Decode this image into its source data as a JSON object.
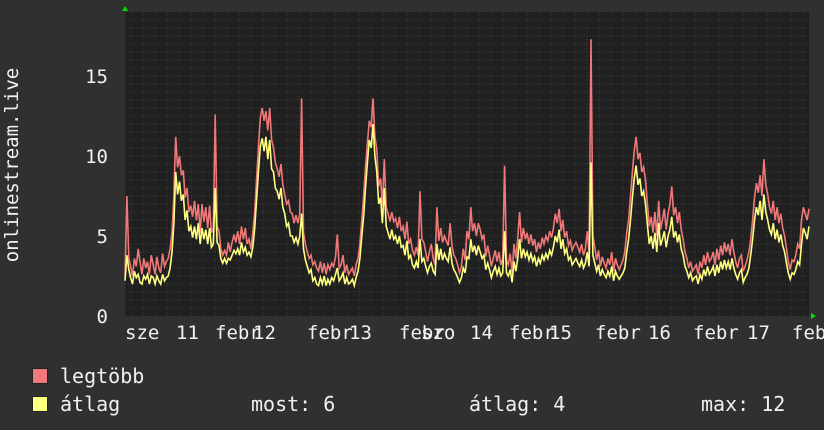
{
  "chart_data": {
    "type": "line",
    "ylabel": "onlinestream.live",
    "ylim": [
      0,
      19
    ],
    "yticks": [
      0,
      5,
      10,
      15
    ],
    "grid": true,
    "xtick_labels": [
      "sze",
      "11",
      "febr",
      "12",
      "febr",
      "13",
      "febr",
      "szo",
      "14",
      "febr",
      "15",
      "febr",
      "16",
      "febr",
      "17",
      "feb"
    ],
    "series": [
      {
        "name": "legtöbb",
        "color": "#f07878",
        "values": [
          2.5,
          7.5,
          3.6,
          3.1,
          2.5,
          3.6,
          3.1,
          4.2,
          3.4,
          2.6,
          3.6,
          3.0,
          3.4,
          2.6,
          3.8,
          3.2,
          2.6,
          3.7,
          3.0,
          2.7,
          3.9,
          3.1,
          3.4,
          3.6,
          4.2,
          5.2,
          7.6,
          11.2,
          9.3,
          10.0,
          8.8,
          9.1,
          7.4,
          8.0,
          6.5,
          6.9,
          6.2,
          7.2,
          6.0,
          7.0,
          5.2,
          7.0,
          5.9,
          6.8,
          5.5,
          6.9,
          5.2,
          5.5,
          12.6,
          5.6,
          5.3,
          4.2,
          3.8,
          4.1,
          3.8,
          4.6,
          4.0,
          4.6,
          5.1,
          4.6,
          5.3,
          4.5,
          5.6,
          4.8,
          5.5,
          4.5,
          4.8,
          4.2,
          5.2,
          6.5,
          8.5,
          10.5,
          12.4,
          13.0,
          12.2,
          12.8,
          11.6,
          13.0,
          11.0,
          10.5,
          9.6,
          9.2,
          8.7,
          9.5,
          8.2,
          7.6,
          7.0,
          7.2,
          6.5,
          6.4,
          5.8,
          6.3,
          5.8,
          6.4,
          13.6,
          5.2,
          4.5,
          4.0,
          3.6,
          3.8,
          3.2,
          3.4,
          3.0,
          2.8,
          3.4,
          2.7,
          3.3,
          2.6,
          3.2,
          2.9,
          3.3,
          3.1,
          3.7,
          5.1,
          3.0,
          3.2,
          3.8,
          2.7,
          3.2,
          2.6,
          2.8,
          3.0,
          2.5,
          3.2,
          3.6,
          4.5,
          6.0,
          7.5,
          9.3,
          10.8,
          12.2,
          11.8,
          13.6,
          11.2,
          10.4,
          8.1,
          8.6,
          6.9,
          9.8,
          6.8,
          6.4,
          5.9,
          6.5,
          5.9,
          6.1,
          5.5,
          6.2,
          5.3,
          5.6,
          4.8,
          5.9,
          4.5,
          4.8,
          4.1,
          3.8,
          4.3,
          3.8,
          7.8,
          4.8,
          4.6,
          4.0,
          3.4,
          4.0,
          4.5,
          3.6,
          3.2,
          6.8,
          4.7,
          5.5,
          4.6,
          5.0,
          4.7,
          4.4,
          5.8,
          4.4,
          3.8,
          3.6,
          3.2,
          2.7,
          3.1,
          4.2,
          3.5,
          5.3,
          4.8,
          6.8,
          5.3,
          5.8,
          5.0,
          5.8,
          5.4,
          4.8,
          5.1,
          3.7,
          4.4,
          3.8,
          3.1,
          3.6,
          4.1,
          3.4,
          4.0,
          3.2,
          3.6,
          9.4,
          3.5,
          3.2,
          3.9,
          2.7,
          4.5,
          3.6,
          4.8,
          6.5,
          4.6,
          5.5,
          4.8,
          5.2,
          4.5,
          5.1,
          4.4,
          4.8,
          4.0,
          4.6,
          4.2,
          4.9,
          4.5,
          5.0,
          4.7,
          5.3,
          4.9,
          5.5,
          6.4,
          5.8,
          6.7,
          5.3,
          6.0,
          4.9,
          5.3,
          4.4,
          4.7,
          4.1,
          4.4,
          4.6,
          4.3,
          4.0,
          4.5,
          3.8,
          4.2,
          5.3,
          4.0,
          17.3,
          5.0,
          4.3,
          3.5,
          4.1,
          3.1,
          3.7,
          3.3,
          3.0,
          3.6,
          3.2,
          4.0,
          2.8,
          3.6,
          3.2,
          2.9,
          3.2,
          3.5,
          4.0,
          5.2,
          6.0,
          7.5,
          9.0,
          10.3,
          11.2,
          9.8,
          10.2,
          9.0,
          9.3,
          8.5,
          7.0,
          5.6,
          6.2,
          5.2,
          6.5,
          5.0,
          7.2,
          5.4,
          6.0,
          6.7,
          5.4,
          6.4,
          7.0,
          8.1,
          6.3,
          6.8,
          5.8,
          6.5,
          5.4,
          4.8,
          4.0,
          3.6,
          3.0,
          3.4,
          2.8,
          3.0,
          3.2,
          2.6,
          3.4,
          3.0,
          3.8,
          3.2,
          4.0,
          3.4,
          3.6,
          4.0,
          3.2,
          4.2,
          3.5,
          4.4,
          3.8,
          4.6,
          4.0,
          4.5,
          3.8,
          4.8,
          4.0,
          3.4,
          3.0,
          3.6,
          3.8,
          2.8,
          3.1,
          3.5,
          4.0,
          4.8,
          6.0,
          7.4,
          8.3,
          7.7,
          8.8,
          7.5,
          9.8,
          8.2,
          7.6,
          6.8,
          6.4,
          7.2,
          6.0,
          6.8,
          5.8,
          6.4,
          5.5,
          5.0,
          4.2,
          3.4,
          2.9,
          3.5,
          3.4,
          3.8,
          4.5,
          4.2,
          6.0,
          6.8,
          6.4,
          6.0,
          6.7
        ]
      },
      {
        "name": "átlag",
        "color": "#ffff80",
        "values": [
          2.2,
          3.8,
          2.9,
          2.4,
          2.0,
          2.8,
          2.4,
          2.6,
          2.1,
          2.0,
          2.5,
          2.3,
          2.6,
          2.0,
          2.5,
          2.4,
          2.0,
          2.5,
          2.2,
          2.0,
          2.6,
          2.2,
          2.4,
          2.5,
          3.0,
          4.0,
          5.8,
          9.0,
          7.6,
          8.4,
          7.2,
          7.6,
          6.0,
          6.6,
          5.3,
          5.6,
          4.9,
          5.6,
          4.8,
          5.8,
          4.5,
          5.5,
          4.8,
          5.4,
          4.5,
          5.5,
          4.3,
          4.5,
          8.0,
          4.6,
          4.4,
          3.6,
          3.3,
          3.6,
          3.3,
          3.6,
          3.5,
          3.8,
          4.1,
          3.9,
          4.2,
          3.8,
          4.6,
          4.0,
          4.3,
          3.8,
          4.0,
          3.7,
          4.3,
          5.5,
          7.2,
          9.0,
          10.6,
          11.1,
          10.3,
          11.2,
          9.8,
          11.0,
          9.2,
          9.0,
          8.0,
          7.8,
          7.3,
          8.0,
          6.8,
          6.4,
          5.6,
          5.8,
          5.0,
          5.0,
          4.6,
          4.9,
          4.5,
          5.0,
          6.4,
          4.2,
          3.5,
          3.1,
          2.7,
          2.9,
          2.2,
          2.4,
          2.0,
          1.9,
          2.4,
          2.0,
          2.5,
          1.9,
          2.3,
          2.0,
          2.4,
          2.2,
          2.6,
          3.0,
          2.2,
          2.4,
          2.7,
          2.0,
          2.4,
          2.0,
          2.1,
          2.3,
          1.9,
          2.4,
          2.8,
          3.6,
          5.0,
          6.2,
          8.0,
          9.6,
          11.0,
          10.5,
          12.0,
          10.0,
          9.0,
          7.0,
          7.4,
          5.8,
          8.0,
          5.6,
          5.2,
          4.8,
          5.4,
          4.8,
          5.0,
          4.5,
          5.0,
          4.3,
          4.4,
          3.8,
          4.7,
          3.6,
          3.8,
          3.2,
          3.0,
          3.4,
          3.0,
          4.8,
          3.4,
          3.6,
          3.1,
          2.7,
          3.1,
          3.3,
          2.8,
          2.6,
          4.5,
          3.5,
          4.2,
          3.5,
          3.9,
          3.6,
          3.4,
          4.3,
          3.3,
          2.9,
          2.7,
          2.4,
          2.1,
          2.4,
          3.0,
          2.7,
          3.7,
          3.6,
          4.8,
          4.0,
          4.4,
          3.8,
          4.4,
          4.0,
          3.6,
          3.8,
          2.9,
          3.3,
          2.9,
          2.4,
          2.8,
          3.1,
          2.6,
          3.0,
          2.5,
          2.7,
          5.3,
          2.7,
          2.5,
          2.9,
          2.1,
          3.4,
          2.8,
          3.6,
          4.8,
          3.6,
          4.2,
          3.7,
          4.0,
          3.5,
          3.9,
          3.4,
          3.7,
          3.1,
          3.6,
          3.3,
          3.8,
          3.5,
          3.9,
          3.6,
          4.1,
          3.8,
          4.3,
          5.0,
          4.6,
          5.4,
          4.2,
          4.8,
          3.9,
          4.2,
          3.5,
          3.7,
          3.2,
          3.4,
          3.6,
          3.3,
          3.1,
          3.5,
          3.0,
          3.3,
          4.0,
          3.1,
          9.6,
          3.8,
          3.3,
          2.8,
          3.2,
          2.5,
          2.9,
          2.6,
          2.4,
          2.8,
          2.5,
          3.1,
          2.2,
          2.8,
          2.5,
          2.3,
          2.5,
          2.7,
          3.0,
          4.0,
          4.8,
          6.0,
          7.4,
          8.6,
          9.4,
          8.2,
          8.6,
          7.5,
          7.8,
          7.0,
          5.7,
          4.5,
          5.0,
          4.2,
          5.2,
          4.0,
          5.8,
          4.4,
          4.8,
          5.3,
          4.3,
          5.0,
          5.4,
          6.2,
          4.9,
          5.3,
          4.6,
          5.1,
          4.2,
          3.8,
          3.1,
          2.8,
          2.4,
          2.7,
          2.2,
          2.4,
          2.5,
          2.0,
          2.6,
          2.3,
          2.9,
          2.5,
          3.1,
          2.6,
          2.8,
          3.1,
          2.5,
          3.2,
          2.7,
          3.4,
          2.9,
          3.5,
          3.0,
          3.4,
          2.9,
          3.6,
          3.0,
          2.6,
          2.3,
          2.7,
          2.9,
          2.1,
          2.4,
          2.6,
          3.0,
          3.8,
          4.8,
          6.0,
          6.8,
          6.3,
          7.2,
          6.0,
          7.6,
          6.5,
          6.0,
          5.4,
          5.1,
          5.8,
          4.8,
          5.4,
          4.6,
          5.1,
          4.4,
          4.0,
          3.3,
          2.7,
          2.3,
          2.7,
          2.6,
          2.9,
          3.4,
          3.2,
          4.5,
          5.5,
          5.2,
          4.8,
          5.6
        ]
      }
    ]
  },
  "legend": {
    "max_label": "legtöbb",
    "avg_label": "átlag"
  },
  "stats": {
    "current": "most: 6",
    "average": "átlag: 4",
    "max": "max: 12"
  },
  "colors": {
    "background": "#303030",
    "plot_bg": "#202020",
    "grid": "#4a4a4a",
    "axis_arrow": "#00e000"
  }
}
